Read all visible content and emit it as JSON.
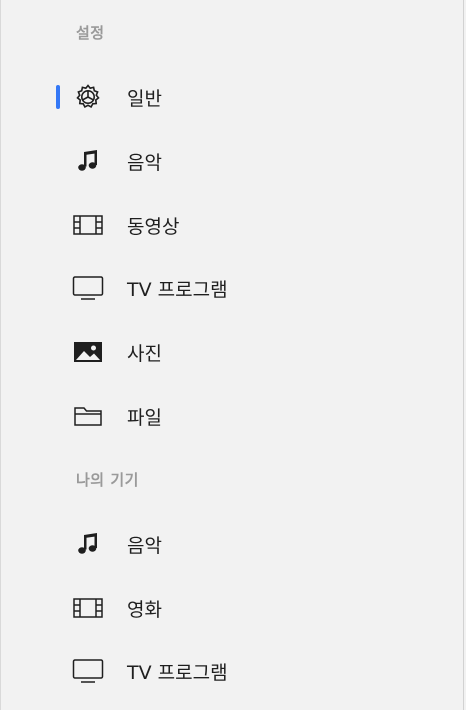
{
  "sections": {
    "settings": {
      "header": "설정",
      "items": [
        {
          "label": "일반",
          "icon": "gear-icon",
          "selected": true
        },
        {
          "label": "음악",
          "icon": "music-note-icon"
        },
        {
          "label": "동영상",
          "icon": "film-icon"
        },
        {
          "label": "TV 프로그램",
          "icon": "tv-icon"
        },
        {
          "label": "사진",
          "icon": "photo-icon"
        },
        {
          "label": "파일",
          "icon": "folder-icon"
        }
      ]
    },
    "device": {
      "header": "나의 기기",
      "items": [
        {
          "label": "음악",
          "icon": "music-note-icon"
        },
        {
          "label": "영화",
          "icon": "film-icon"
        },
        {
          "label": "TV 프로그램",
          "icon": "tv-icon"
        }
      ]
    }
  },
  "colors": {
    "accent": "#3478f6",
    "background": "#f2f2f2",
    "header_text": "#9a9a9a",
    "label_text": "#1f1f1f"
  }
}
